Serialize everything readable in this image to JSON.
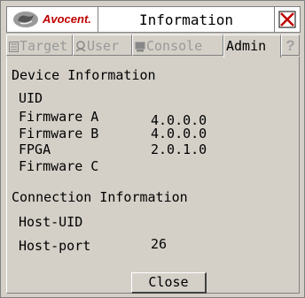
{
  "window": {
    "brand": "Avocent.",
    "title": "Information"
  },
  "tabs": [
    {
      "label": "Target",
      "icon": "target-icon",
      "active": false
    },
    {
      "label": "User",
      "icon": "user-icon",
      "active": false
    },
    {
      "label": "Console",
      "icon": "console-icon",
      "active": false
    },
    {
      "label": "Admin",
      "icon": "",
      "active": true
    }
  ],
  "help_label": "?",
  "device": {
    "heading": "Device Information",
    "rows": [
      {
        "label": "UID",
        "value": ""
      },
      {
        "label": "Firmware A",
        "value": "4.0.0.0"
      },
      {
        "label": "Firmware B",
        "value": "4.0.0.0"
      },
      {
        "label": "FPGA",
        "value": "2.0.1.0"
      },
      {
        "label": "Firmware C",
        "value": ""
      }
    ]
  },
  "connection": {
    "heading": "Connection Information",
    "rows": [
      {
        "label": "Host-UID",
        "value": ""
      },
      {
        "label": "Host-port",
        "value": "26"
      }
    ]
  },
  "buttons": {
    "close": "Close"
  },
  "colors": {
    "background": "#d4d0c8",
    "brand_red": "#c00000",
    "disabled_text": "#999999"
  }
}
